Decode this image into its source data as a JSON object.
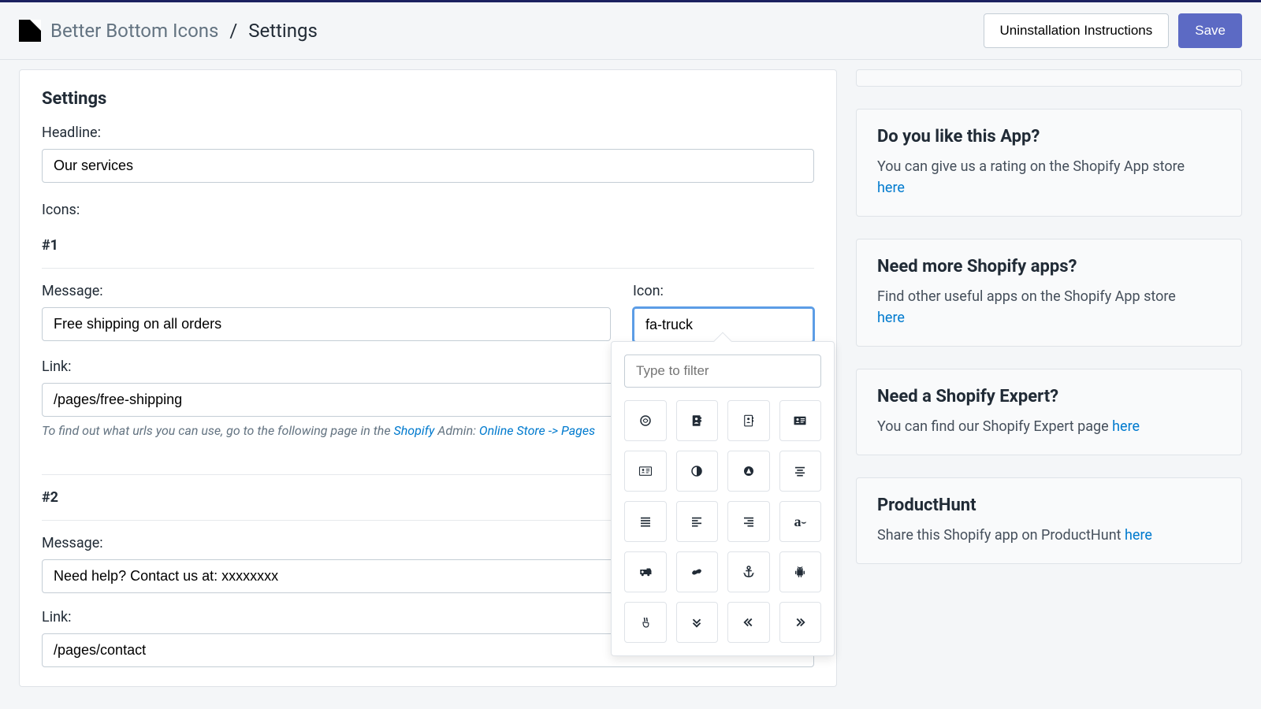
{
  "breadcrumb": {
    "app": "Better Bottom Icons",
    "sep": "/",
    "current": "Settings"
  },
  "header": {
    "uninstall": "Uninstallation Instructions",
    "save": "Save"
  },
  "card": {
    "title": "Settings",
    "headline_label": "Headline:",
    "headline_value": "Our services",
    "icons_label": "Icons:",
    "section1": "#1",
    "section2": "#2",
    "message_label": "Message:",
    "icon_label": "Icon:",
    "link_label": "Link:",
    "msg1": "Free shipping on all orders",
    "icon1": "fa-truck",
    "link1": "/pages/free-shipping",
    "msg2": "Need help? Contact us at: xxxxxxxx",
    "link2": "/pages/contact",
    "help_pre": "To find out what urls you can use, go to the following page in the ",
    "help_shopify": "Shopify",
    "help_mid": " Admin: ",
    "help_link": "Online Store -> Pages"
  },
  "picker": {
    "filter_placeholder": "Type to filter"
  },
  "sidebar": {
    "like": {
      "title": "Do you like this App?",
      "text": "You can give us a rating on the Shopify App store ",
      "link": "here"
    },
    "more": {
      "title": "Need more Shopify apps?",
      "text": "Find other useful apps on the Shopify App store ",
      "link": "here"
    },
    "expert": {
      "title": "Need a Shopify Expert?",
      "text": "You can find our Shopify Expert page ",
      "link": "here"
    },
    "ph": {
      "title": "ProductHunt",
      "text": "Share this Shopify app on ProductHunt ",
      "link": "here"
    }
  }
}
